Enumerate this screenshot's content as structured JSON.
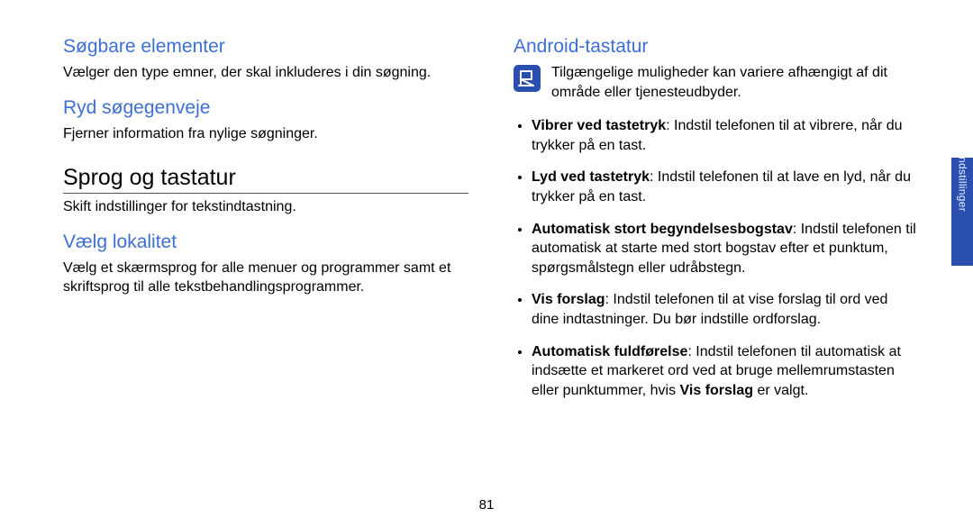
{
  "left": {
    "sogbare": {
      "heading": "Søgbare elementer",
      "body": "Vælger den type emner, der skal inkluderes i din søgning."
    },
    "ryd": {
      "heading": "Ryd søgegenveje",
      "body": "Fjerner information fra nylige søgninger."
    },
    "sprog": {
      "heading": "Sprog og tastatur",
      "body": "Skift indstillinger for tekstindtastning."
    },
    "lokalitet": {
      "heading": "Vælg lokalitet",
      "body": "Vælg et skærmsprog for alle menuer og programmer samt et skriftsprog til alle tekstbehandlingsprogrammer."
    }
  },
  "right": {
    "android": {
      "heading": "Android-tastatur",
      "note": "Tilgængelige muligheder kan variere afhængigt af dit område eller tjenesteudbyder.",
      "bullets": [
        {
          "bold": "Vibrer ved tastetryk",
          "rest": ": Indstil telefonen til at vibrere, når du trykker på en tast."
        },
        {
          "bold": "Lyd ved tastetryk",
          "rest": ": Indstil telefonen til at lave en lyd, når du trykker på en tast."
        },
        {
          "bold": "Automatisk stort begyndelsesbogstav",
          "rest": ": Indstil telefonen til automatisk at starte med stort bogstav efter et punktum, spørgsmålstegn eller udråbstegn."
        },
        {
          "bold": "Vis forslag",
          "rest": ": Indstil telefonen til at vise forslag til ord ved dine indtastninger. Du bør indstille ordforslag."
        },
        {
          "bold": "Automatisk fuldførelse",
          "rest_pre": ": Indstil telefonen til automatisk at indsætte et markeret ord ved at bruge mellemrumstasten eller punktummer, hvis ",
          "rest_bold": "Vis forslag",
          "rest_post": " er valgt."
        }
      ]
    }
  },
  "side_tab": "Indstillinger",
  "page_number": "81"
}
